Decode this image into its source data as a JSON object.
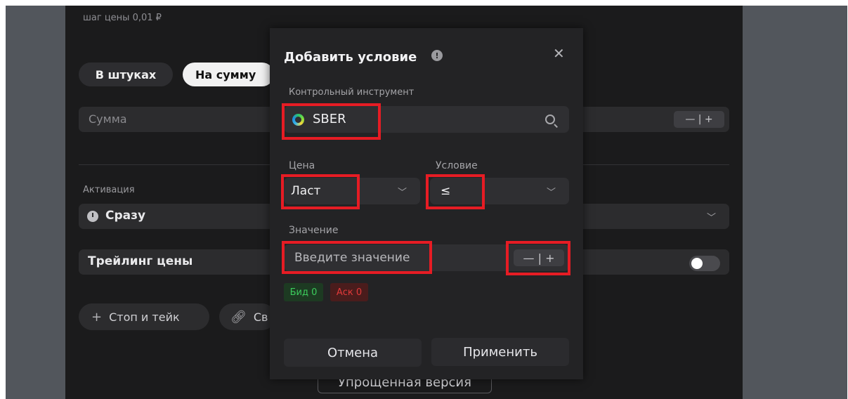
{
  "order_form": {
    "price_step": "шаг цены 0,01 ₽",
    "mode_tabs": [
      "В штуках",
      "На сумму"
    ],
    "sum_placeholder": "Сумма",
    "stepper": "— | +",
    "activation_label": "Активация",
    "activation_value": "Сразу",
    "trailing_label": "Трейлинг цены",
    "trailing_enabled": false,
    "stop_take_label": "Стоп и тейк",
    "linked_label": "Св",
    "simple_version_label": "Упрощенная версия"
  },
  "modal": {
    "title": "Добавить условие",
    "close_glyph": "✕",
    "instrument_label": "Контрольный инструмент",
    "instrument_value": "SBER",
    "price_label": "Цена",
    "price_value": "Ласт",
    "condition_label": "Условие",
    "condition_value": "≤",
    "value_label": "Значение",
    "value_placeholder": "Введите значение",
    "value_stepper": "— | +",
    "bid_badge": "Бид 0",
    "ask_badge": "Аск 0",
    "cancel_label": "Отмена",
    "apply_label": "Применить"
  },
  "colors": {
    "highlight": "#e61c24",
    "bid": "#3ccc5c",
    "ask": "#e23a3a",
    "panel": "#1b1b1c",
    "modal": "#232325"
  }
}
